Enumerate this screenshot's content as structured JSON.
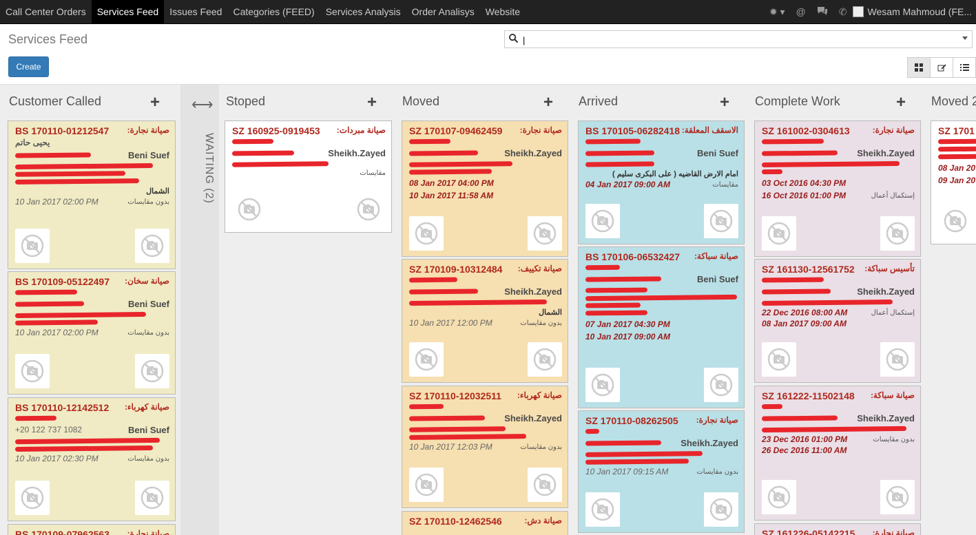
{
  "nav": {
    "items": [
      "Call Center Orders",
      "Services Feed",
      "Issues Feed",
      "Categories (FEED)",
      "Services Analysis",
      "Order Analisys",
      "Website"
    ],
    "active": 1,
    "user": "Wesam Mahmoud (FE..."
  },
  "page": {
    "title": "Services Feed",
    "create_label": "Create",
    "search_value": "|"
  },
  "icons": {
    "search": "search-icon",
    "bug": "bug-icon",
    "at": "at-icon",
    "chat": "chat-icon",
    "phone": "phone-icon",
    "kanban": "kanban-view-icon",
    "form": "form-view-icon",
    "list": "list-view-icon",
    "photo": "no-photo-icon"
  },
  "colors": {
    "yellow": "#f0ebc4",
    "orange": "#f6dfb0",
    "blue": "#b9e0e6",
    "pink": "#eadfe6",
    "title_red": "#b0281e",
    "create_blue": "#337ab7"
  },
  "folded": {
    "label": "WAITING (2)"
  },
  "columns": [
    {
      "name": "Customer Called",
      "cards": [
        {
          "id": "BS 170110-01212547",
          "svc": "صيانة نجارة:",
          "customer": "يحيى حاتم",
          "loc": "Beni Suef",
          "note": "الشمال",
          "date": "10 Jan 2017 02:00 PM",
          "tag": "بدون مقايسات"
        },
        {
          "id": "BS 170109-05122497",
          "svc": "صيانة سخان:",
          "loc": "Beni Suef",
          "date": "10 Jan 2017 02:00 PM",
          "tag": "بدون مقايسات"
        },
        {
          "id": "BS 170110-12142512",
          "svc": "صيانة كهرباء:",
          "phone": "+20 122 737 1082",
          "loc": "Beni Suef",
          "date": "10 Jan 2017 02:30 PM",
          "tag": "بدون مقايسات"
        },
        {
          "id": "BS 170109-07962563",
          "svc": "صيانة نجارة:"
        }
      ]
    },
    {
      "name": "Stoped",
      "cards": [
        {
          "id": "SZ 160925-0919453",
          "svc": "صيانة مبردات:",
          "loc": "Sheikh.Zayed",
          "tag": "مقايسات"
        }
      ]
    },
    {
      "name": "Moved",
      "cards": [
        {
          "id": "SZ 170107-09462459",
          "svc": "صيانة نجارة:",
          "loc": "Sheikh.Zayed",
          "d1": "08 Jan 2017 04:00 PM",
          "d2": "10 Jan 2017 11:58 AM",
          "tag": "بدون مقايسات"
        },
        {
          "id": "SZ 170109-10312484",
          "svc": "صيانة تكييف:",
          "loc": "Sheikh.Zayed",
          "note": "الشمال",
          "date": "10 Jan 2017 12:00 PM",
          "tag": "بدون مقايسات"
        },
        {
          "id": "SZ 170110-12032511",
          "svc": "صيانة كهرباء:",
          "loc": "Sheikh.Zayed",
          "date": "10 Jan 2017 12:03 PM",
          "tag": "بدون مقايسات"
        },
        {
          "id": "SZ 170110-12462546",
          "svc": "صيانة دش:"
        }
      ]
    },
    {
      "name": "Arrived",
      "cards": [
        {
          "id": "BS 170105-06282418",
          "svc": "الاسقف المعلقة:",
          "loc": "Beni Suef",
          "note": "امام الارض القاضيه ( على البكرى سليم )",
          "date_red": "04 Jan 2017 09:00 AM",
          "tag": "مقايسات"
        },
        {
          "id": "BS 170106-06532427",
          "svc": "صيانة سباكة:",
          "loc": "Beni Suef",
          "d1": "07 Jan 2017 04:30 PM",
          "d2": "10 Jan 2017 09:00 AM",
          "tag": "بدون مقايسات"
        },
        {
          "id": "SZ 170110-08262505",
          "svc": "صيانة نجارة:",
          "loc": "Sheikh.Zayed",
          "date": "10 Jan 2017 09:15 AM",
          "tag": "بدون مقايسات"
        }
      ]
    },
    {
      "name": "Complete Work",
      "cards": [
        {
          "id": "SZ 161002-0304613",
          "svc": "صيانة نجارة:",
          "loc": "Sheikh.Zayed",
          "d1": "03 Oct 2016 04:30 PM",
          "d2": "16 Oct 2016 01:00 PM",
          "tag": "إستكمال أعمال"
        },
        {
          "id": "SZ 161130-12561752",
          "svc": "تأسيس سباكة:",
          "loc": "Sheikh.Zayed",
          "d1": "22 Dec 2016 08:00 AM",
          "d2": "08 Jan 2017 09:00 AM",
          "tag": "إستكمال أعمال"
        },
        {
          "id": "SZ 161222-11502148",
          "svc": "صيانة سباكة:",
          "loc": "Sheikh.Zayed",
          "d1": "23 Dec 2016 01:00 PM",
          "d2": "26 Dec 2016 11:00 AM",
          "tag": "بدون مقايسات"
        },
        {
          "id": "SZ 161226-05142215",
          "svc": "صيانة نجارة:"
        }
      ]
    },
    {
      "name": "Moved 2",
      "cards": [
        {
          "id": "SZ 1701",
          "d1": "08 Jan 20",
          "d2": "09 Jan 20"
        }
      ]
    }
  ]
}
